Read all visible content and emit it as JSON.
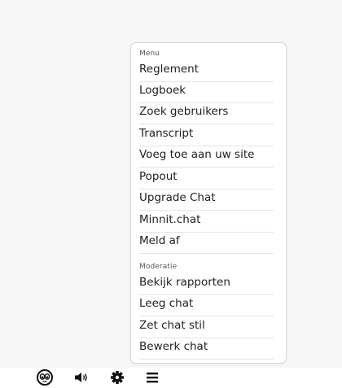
{
  "menu": {
    "heading": "Menu",
    "items": [
      {
        "label": "Reglement"
      },
      {
        "label": "Logboek"
      },
      {
        "label": "Zoek gebruikers"
      },
      {
        "label": "Transcript"
      },
      {
        "label": "Voeg toe aan uw site"
      },
      {
        "label": "Popout"
      },
      {
        "label": "Upgrade Chat"
      },
      {
        "label": "Minnit.chat"
      },
      {
        "label": "Meld af"
      }
    ]
  },
  "moderation": {
    "heading": "Moderatie",
    "items": [
      {
        "label": "Bekijk rapporten"
      },
      {
        "label": "Leeg chat"
      },
      {
        "label": "Zet chat stil"
      },
      {
        "label": "Bewerk chat"
      }
    ]
  },
  "toolbar": {
    "icons": [
      "emoji-icon",
      "speaker-icon",
      "gear-icon",
      "hamburger-menu-icon"
    ]
  }
}
